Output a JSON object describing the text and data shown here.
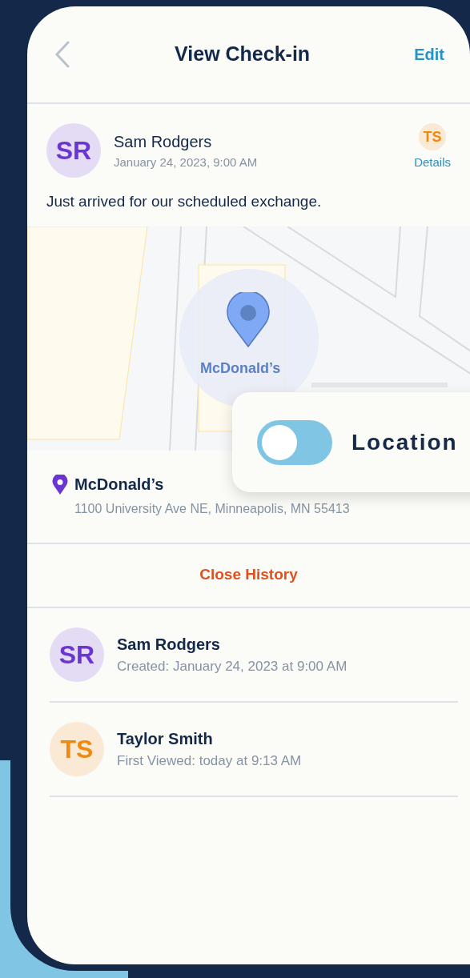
{
  "header": {
    "title": "View Check-in",
    "action": "Edit"
  },
  "post": {
    "author": {
      "initials": "SR",
      "name": "Sam Rodgers",
      "color": "#6b35d1"
    },
    "timestamp": "January 24, 2023, 9:00 AM",
    "recipient": {
      "initials": "TS",
      "color": "#ef8a10"
    },
    "details_link": "Details",
    "message": "Just arrived for our scheduled exchange."
  },
  "map": {
    "pin_label": "McDonald’s"
  },
  "location_toggle": {
    "label": "Location",
    "on": false
  },
  "place": {
    "name": "McDonald’s",
    "address": "1100 University Ave NE, Minneapolis, MN 55413"
  },
  "close_history": "Close History",
  "history": [
    {
      "initials": "SR",
      "name": "Sam Rodgers",
      "detail": "Created: January 24, 2023 at 9:00 AM",
      "color": "#6b35d1"
    },
    {
      "initials": "TS",
      "name": "Taylor Smith",
      "detail": "First Viewed: today at 9:13 AM",
      "color": "#ef8a10"
    }
  ]
}
